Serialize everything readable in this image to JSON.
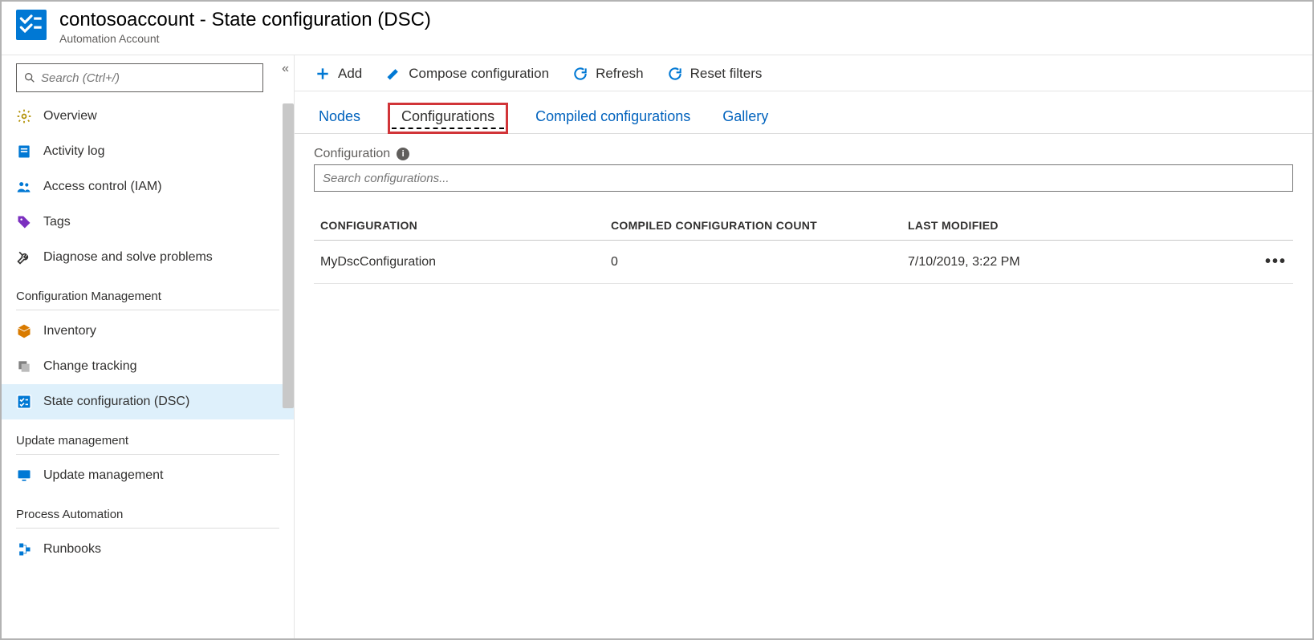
{
  "header": {
    "title": "contosoaccount - State configuration (DSC)",
    "subtitle": "Automation Account"
  },
  "sidebar": {
    "search_placeholder": "Search (Ctrl+/)",
    "items": [
      {
        "icon": "gear-icon",
        "label": "Overview",
        "color": "#b18f00"
      },
      {
        "icon": "log-icon",
        "label": "Activity log",
        "color": "#0078d4"
      },
      {
        "icon": "people-icon",
        "label": "Access control (IAM)",
        "color": "#0078d4"
      },
      {
        "icon": "tag-icon",
        "label": "Tags",
        "color": "#7b2fbf"
      },
      {
        "icon": "wrench-icon",
        "label": "Diagnose and solve problems",
        "color": "#323130"
      }
    ],
    "group1_label": "Configuration Management",
    "group1_items": [
      {
        "icon": "box-icon",
        "label": "Inventory",
        "color": "#d97b00"
      },
      {
        "icon": "stack-icon",
        "label": "Change tracking",
        "color": "#808080"
      },
      {
        "icon": "dsc-icon",
        "label": "State configuration (DSC)",
        "color": "#0078d4"
      }
    ],
    "group2_label": "Update management",
    "group2_items": [
      {
        "icon": "monitor-icon",
        "label": "Update management",
        "color": "#0078d4"
      }
    ],
    "group3_label": "Process Automation",
    "group3_items": [
      {
        "icon": "runbook-icon",
        "label": "Runbooks",
        "color": "#0078d4"
      }
    ]
  },
  "toolbar": {
    "add_label": "Add",
    "compose_label": "Compose configuration",
    "refresh_label": "Refresh",
    "reset_label": "Reset filters"
  },
  "tabs": {
    "nodes": "Nodes",
    "configs": "Configurations",
    "compiled": "Compiled configurations",
    "gallery": "Gallery"
  },
  "filter": {
    "label": "Configuration",
    "placeholder": "Search configurations..."
  },
  "table": {
    "col_config": "CONFIGURATION",
    "col_count": "COMPILED CONFIGURATION COUNT",
    "col_modified": "LAST MODIFIED",
    "rows": [
      {
        "name": "MyDscConfiguration",
        "count": "0",
        "modified": "7/10/2019, 3:22 PM"
      }
    ]
  }
}
